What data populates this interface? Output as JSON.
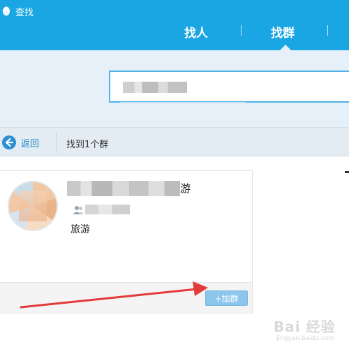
{
  "header": {
    "app_title": "查找",
    "tabs": [
      {
        "label": "找人"
      },
      {
        "label": "找群",
        "active": true
      }
    ],
    "accent_color": "#1aa6e3"
  },
  "search": {
    "value": "",
    "placeholder": ""
  },
  "toolbar": {
    "back_label": "返回",
    "result_count": "找到1个群"
  },
  "result_card": {
    "name_visible_suffix": "游",
    "tag": "旅游",
    "join_button_label": "+加群",
    "join_button_color": "#8cc6ec"
  },
  "watermark": {
    "logo": "Bai 经验",
    "sub": "jingyan.baidu.com"
  },
  "annotation": {
    "arrow_color": "#e33a3a"
  }
}
